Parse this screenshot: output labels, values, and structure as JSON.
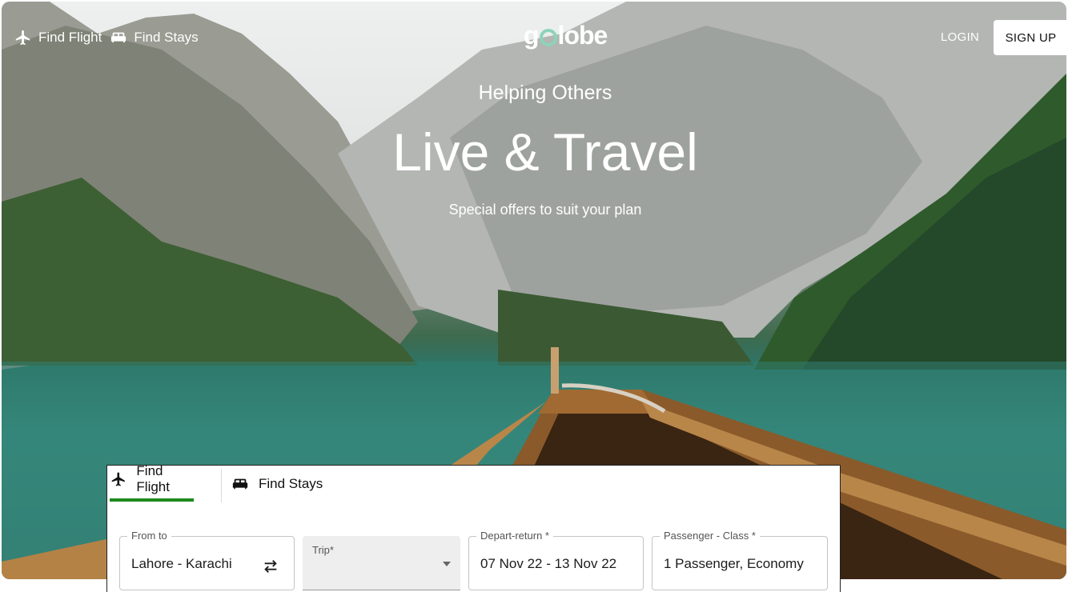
{
  "nav": {
    "find_flight": "Find Flight",
    "find_stays": "Find Stays",
    "login": "LOGIN",
    "signup": "SIGN UP"
  },
  "logo": {
    "text_before": "g",
    "text_after": "lobe"
  },
  "hero": {
    "subtitle": "Helping Others",
    "title": "Live & Travel",
    "offer": "Special offers to suit your plan"
  },
  "search": {
    "tabs": [
      {
        "label": "Find Flight",
        "icon": "airplane-icon",
        "active": true
      },
      {
        "label": "Find Stays",
        "icon": "bed-icon",
        "active": false
      }
    ],
    "fields": {
      "from_to": {
        "label": "From to",
        "value": "Lahore - Karachi",
        "icon": "swap-icon"
      },
      "trip": {
        "label": "Trip*",
        "value": "",
        "icon": "dropdown-arrow-icon"
      },
      "depart_return": {
        "label": "Depart-return *",
        "value": "07 Nov 22 - 13 Nov 22"
      },
      "passenger_class": {
        "label": "Passenger - Class *",
        "value": "1 Passenger, Economy"
      }
    }
  },
  "colors": {
    "accent_green": "#1c8a1c",
    "logo_mint": "#8dd3bb"
  }
}
